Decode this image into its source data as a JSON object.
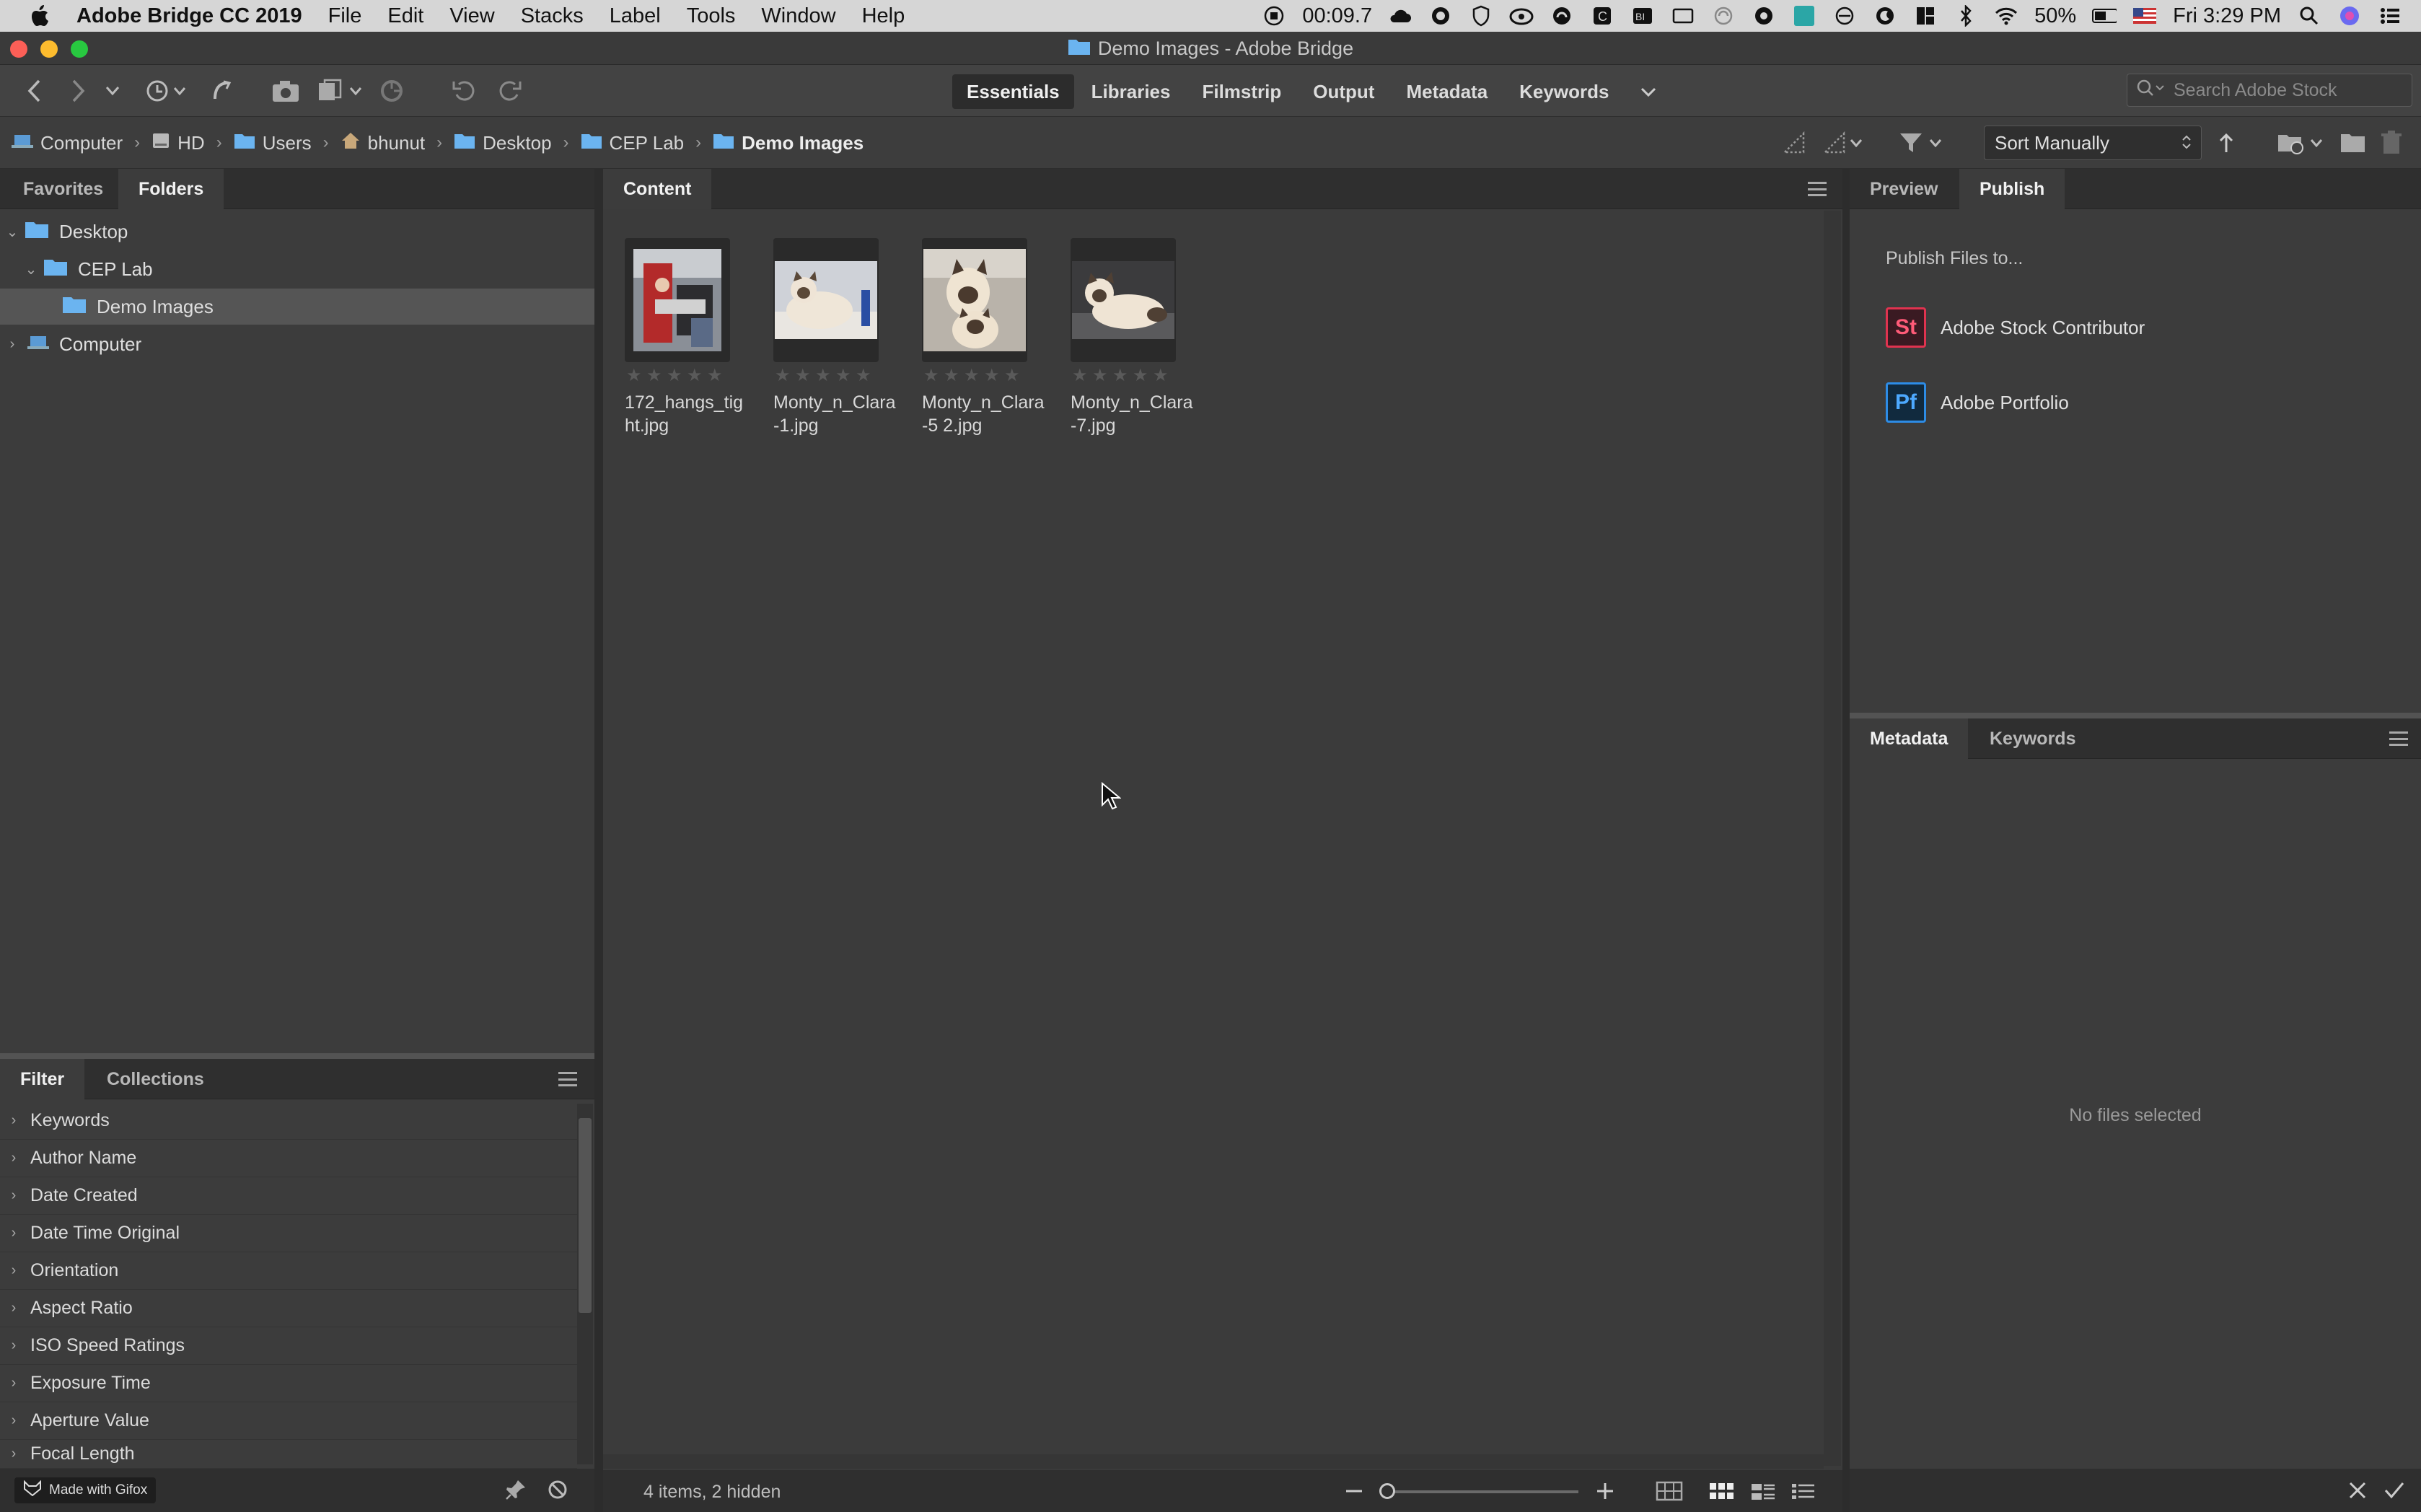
{
  "menubar": {
    "app_name": "Adobe Bridge CC 2019",
    "items": [
      "File",
      "Edit",
      "View",
      "Stacks",
      "Label",
      "Tools",
      "Window",
      "Help"
    ],
    "recording_time": "00:09.7",
    "battery": "50%",
    "clock": "Fri 3:29 PM"
  },
  "window": {
    "title": "Demo Images - Adobe Bridge"
  },
  "toolbar": {
    "workspaces": [
      "Essentials",
      "Libraries",
      "Filmstrip",
      "Output",
      "Metadata",
      "Keywords"
    ],
    "active_workspace": "Essentials",
    "search_placeholder": "Search Adobe Stock"
  },
  "path": {
    "crumbs": [
      "Computer",
      "HD",
      "Users",
      "bhunut",
      "Desktop",
      "CEP Lab",
      "Demo Images"
    ],
    "sort_label": "Sort Manually"
  },
  "left_panel": {
    "tabs": [
      "Favorites",
      "Folders"
    ],
    "active_tab": "Folders",
    "tree": [
      {
        "label": "Desktop",
        "expanded": true
      },
      {
        "label": "CEP Lab",
        "expanded": true
      },
      {
        "label": "Demo Images",
        "selected": true
      },
      {
        "label": "Computer",
        "expanded": false
      }
    ]
  },
  "filter_panel": {
    "tabs": [
      "Filter",
      "Collections"
    ],
    "active_tab": "Filter",
    "items": [
      "Keywords",
      "Author Name",
      "Date Created",
      "Date Time Original",
      "Orientation",
      "Aspect Ratio",
      "ISO Speed Ratings",
      "Exposure Time",
      "Aperture Value",
      "Focal Length"
    ],
    "watermark": "Made with Gifox"
  },
  "content": {
    "tab": "Content",
    "files": [
      {
        "name": "172_hangs_tight.jpg",
        "rating": 0
      },
      {
        "name": "Monty_n_Clara-1.jpg",
        "rating": 0
      },
      {
        "name": "Monty_n_Clara-5 2.jpg",
        "rating": 0
      },
      {
        "name": "Monty_n_Clara-7.jpg",
        "rating": 0
      }
    ],
    "status": "4 items, 2 hidden"
  },
  "right_panel": {
    "tabs": [
      "Preview",
      "Publish"
    ],
    "active_tab": "Publish",
    "publish_heading": "Publish Files to...",
    "services": [
      {
        "logo": "St",
        "label": "Adobe Stock Contributor",
        "color": "#e0334f"
      },
      {
        "logo": "Pf",
        "label": "Adobe Portfolio",
        "color": "#2d8ce6"
      }
    ]
  },
  "metadata_panel": {
    "tabs": [
      "Metadata",
      "Keywords"
    ],
    "active_tab": "Metadata",
    "empty_text": "No files selected"
  },
  "colors": {
    "panel_bg": "#3c3c3c",
    "tab_bar": "#2f2f2f",
    "folder_blue": "#6bb4f0"
  }
}
